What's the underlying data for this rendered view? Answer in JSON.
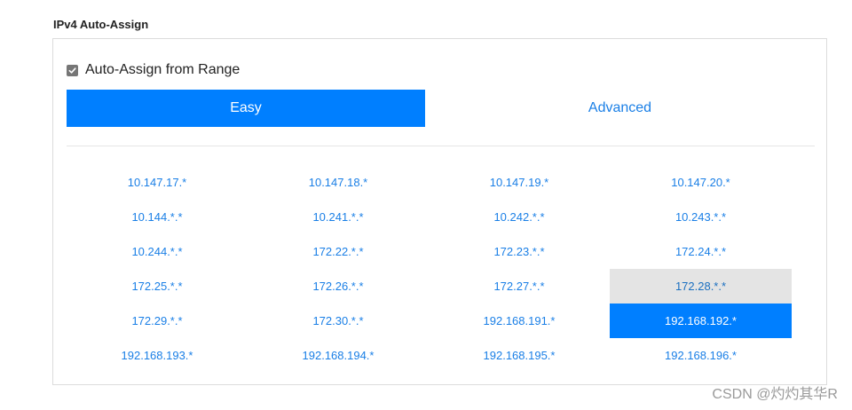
{
  "section": {
    "title": "IPv4 Auto-Assign"
  },
  "checkbox": {
    "label": "Auto-Assign from Range",
    "checked": true
  },
  "tabs": [
    {
      "label": "Easy",
      "active": true
    },
    {
      "label": "Advanced",
      "active": false
    }
  ],
  "colors": {
    "accent": "#007fff",
    "link": "#1a7fe6",
    "hover_bg": "#e4e4e4"
  },
  "ranges": [
    "10.147.17.*",
    "10.147.18.*",
    "10.147.19.*",
    "10.147.20.*",
    "10.144.*.*",
    "10.241.*.*",
    "10.242.*.*",
    "10.243.*.*",
    "10.244.*.*",
    "172.22.*.*",
    "172.23.*.*",
    "172.24.*.*",
    "172.25.*.*",
    "172.26.*.*",
    "172.27.*.*",
    "172.28.*.*",
    "172.29.*.*",
    "172.30.*.*",
    "192.168.191.*",
    "192.168.192.*",
    "192.168.193.*",
    "192.168.194.*",
    "192.168.195.*",
    "192.168.196.*"
  ],
  "selected_range": "192.168.192.*",
  "hovered_range": "172.28.*.*",
  "watermark": "CSDN @灼灼其华R"
}
